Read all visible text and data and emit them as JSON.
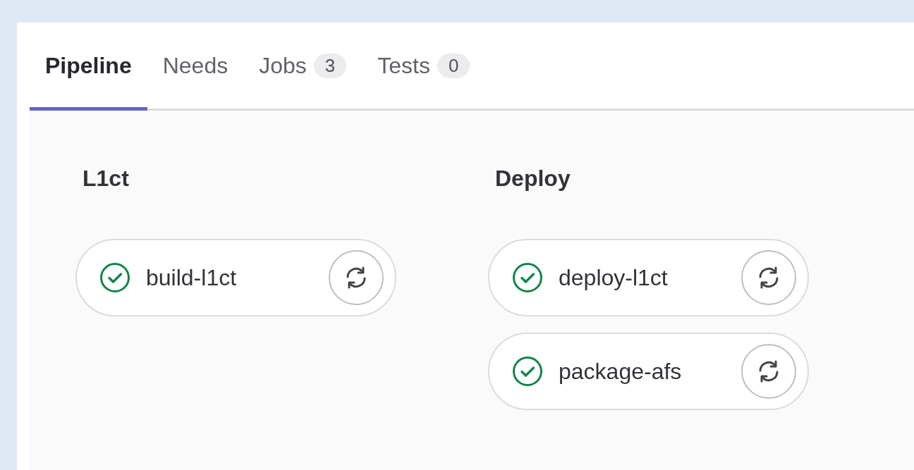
{
  "tabs": [
    {
      "label": "Pipeline",
      "selected": true
    },
    {
      "label": "Needs",
      "selected": false
    },
    {
      "label": "Jobs",
      "count": "3",
      "selected": false
    },
    {
      "label": "Tests",
      "count": "0",
      "selected": false
    }
  ],
  "stages": [
    {
      "title": "L1ct",
      "jobs": [
        {
          "name": "build-l1ct",
          "kind": "success"
        }
      ]
    },
    {
      "title": "Deploy",
      "jobs": [
        {
          "name": "deploy-l1ct",
          "kind": "success"
        },
        {
          "name": "package-afs",
          "kind": "success"
        }
      ]
    }
  ]
}
